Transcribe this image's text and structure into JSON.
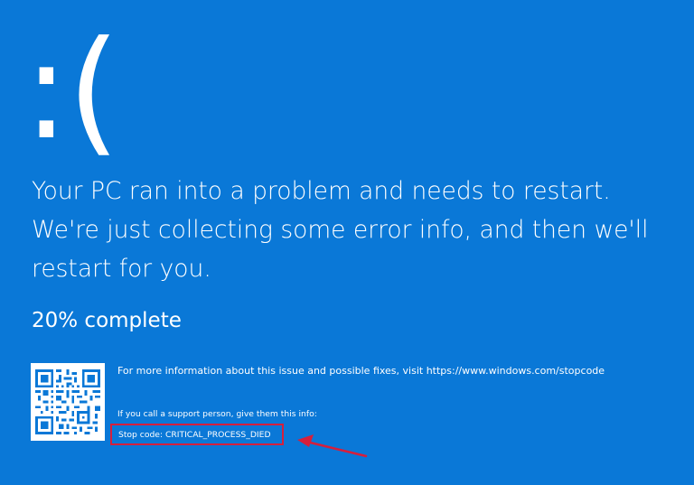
{
  "screen": {
    "emoticon": ":(",
    "message": "Your PC ran into a problem and needs to restart. We're just collecting some error info, and then we'll restart for you.",
    "progress_text": "20% complete",
    "progress_percent": 20,
    "more_info": "For more information about this issue and possible fixes, visit https://www.windows.com/stopcode",
    "support_info": "If you call a support person, give them this info:",
    "stop_code": "Stop code: CRITICAL_PROCESS_DIED"
  },
  "icons": {
    "qr": "qr-code-icon",
    "annotation": "red-arrow-annotation"
  },
  "colors": {
    "background": "#0a78d7",
    "text": "#ffffff",
    "annotation": "#d61f3c"
  }
}
